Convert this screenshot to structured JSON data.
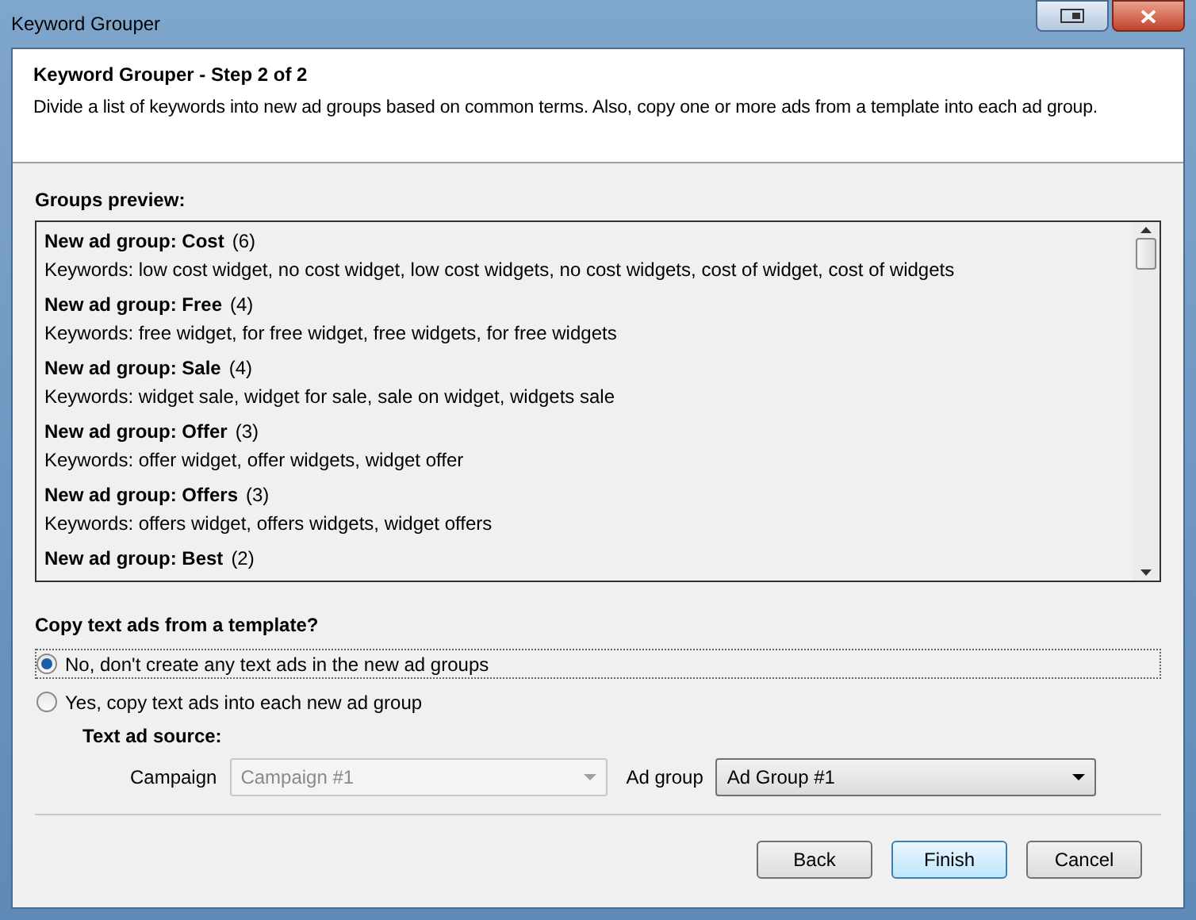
{
  "window": {
    "title": "Keyword Grouper"
  },
  "header": {
    "title": "Keyword Grouper - Step 2 of 2",
    "description": "Divide a list of keywords into new ad groups based on common terms. Also, copy one or more ads from a template into each ad group."
  },
  "groups_preview": {
    "label": "Groups preview:",
    "groups": [
      {
        "name": "New ad group: Cost",
        "count": "(6)",
        "keywords": "Keywords: low cost widget, no cost widget, low cost widgets, no cost widgets, cost of widget, cost of widgets"
      },
      {
        "name": "New ad group: Free",
        "count": "(4)",
        "keywords": "Keywords: free widget, for free widget, free widgets, for free widgets"
      },
      {
        "name": "New ad group: Sale",
        "count": "(4)",
        "keywords": "Keywords: widget sale, widget for sale, sale on widget, widgets sale"
      },
      {
        "name": "New ad group: Offer",
        "count": "(3)",
        "keywords": "Keywords: offer widget, offer widgets, widget offer"
      },
      {
        "name": "New ad group: Offers",
        "count": "(3)",
        "keywords": "Keywords: offers widget, offers widgets, widget offers"
      },
      {
        "name": "New ad group: Best",
        "count": "(2)"
      }
    ]
  },
  "copy_ads": {
    "label": "Copy text ads from a template?",
    "options": [
      {
        "label": "No, don't create any text ads in the new ad groups",
        "selected": true
      },
      {
        "label": "Yes, copy text ads into each new ad group",
        "selected": false
      }
    ],
    "source_label": "Text ad source:",
    "fields": [
      {
        "label": "Campaign",
        "value": "Campaign #1",
        "disabled": true
      },
      {
        "label": "Ad group",
        "value": "Ad Group #1",
        "disabled": false
      }
    ]
  },
  "buttons": [
    {
      "label": "Back",
      "default": false
    },
    {
      "label": "Finish",
      "default": true
    },
    {
      "label": "Cancel",
      "default": false
    }
  ]
}
